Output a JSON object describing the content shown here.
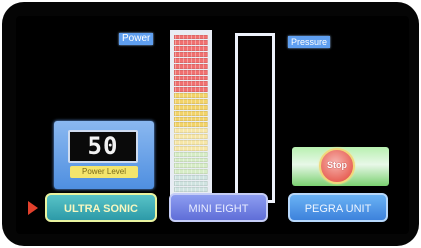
{
  "labels": {
    "power": "Power",
    "pressure": "Pressure"
  },
  "power_level": {
    "value": "50",
    "label": "Power Level"
  },
  "power_bar": {
    "segments_total": 28,
    "segment_colors": [
      "#f07070",
      "#f07070",
      "#f07070",
      "#f07070",
      "#f07070",
      "#f07070",
      "#f07070",
      "#f07070",
      "#f07070",
      "#f07070",
      "#f2d36a",
      "#f2d36a",
      "#f2d36a",
      "#f2d36a",
      "#f2d36a",
      "#f2d36a",
      "#f6e6a8",
      "#f6e6a8",
      "#f6e6a8",
      "#f6e6a8",
      "#d6ecc6",
      "#d6ecc6",
      "#d6ecc6",
      "#d6ecc6",
      "#cfe3e0",
      "#cfe3e0",
      "#cfe3e0",
      "#cfe3e0"
    ]
  },
  "pressure_bar": {
    "fill_fraction": 0.0
  },
  "stop": {
    "label": "Stop"
  },
  "modes": [
    {
      "label": "ULTRA SONIC",
      "selected": true
    },
    {
      "label": "MINI EIGHT",
      "selected": false
    },
    {
      "label": "PEGRA UNIT",
      "selected": false
    }
  ],
  "colors": {
    "accent_blue": "#5f9ff0",
    "selector_arrow": "#e2402c"
  }
}
